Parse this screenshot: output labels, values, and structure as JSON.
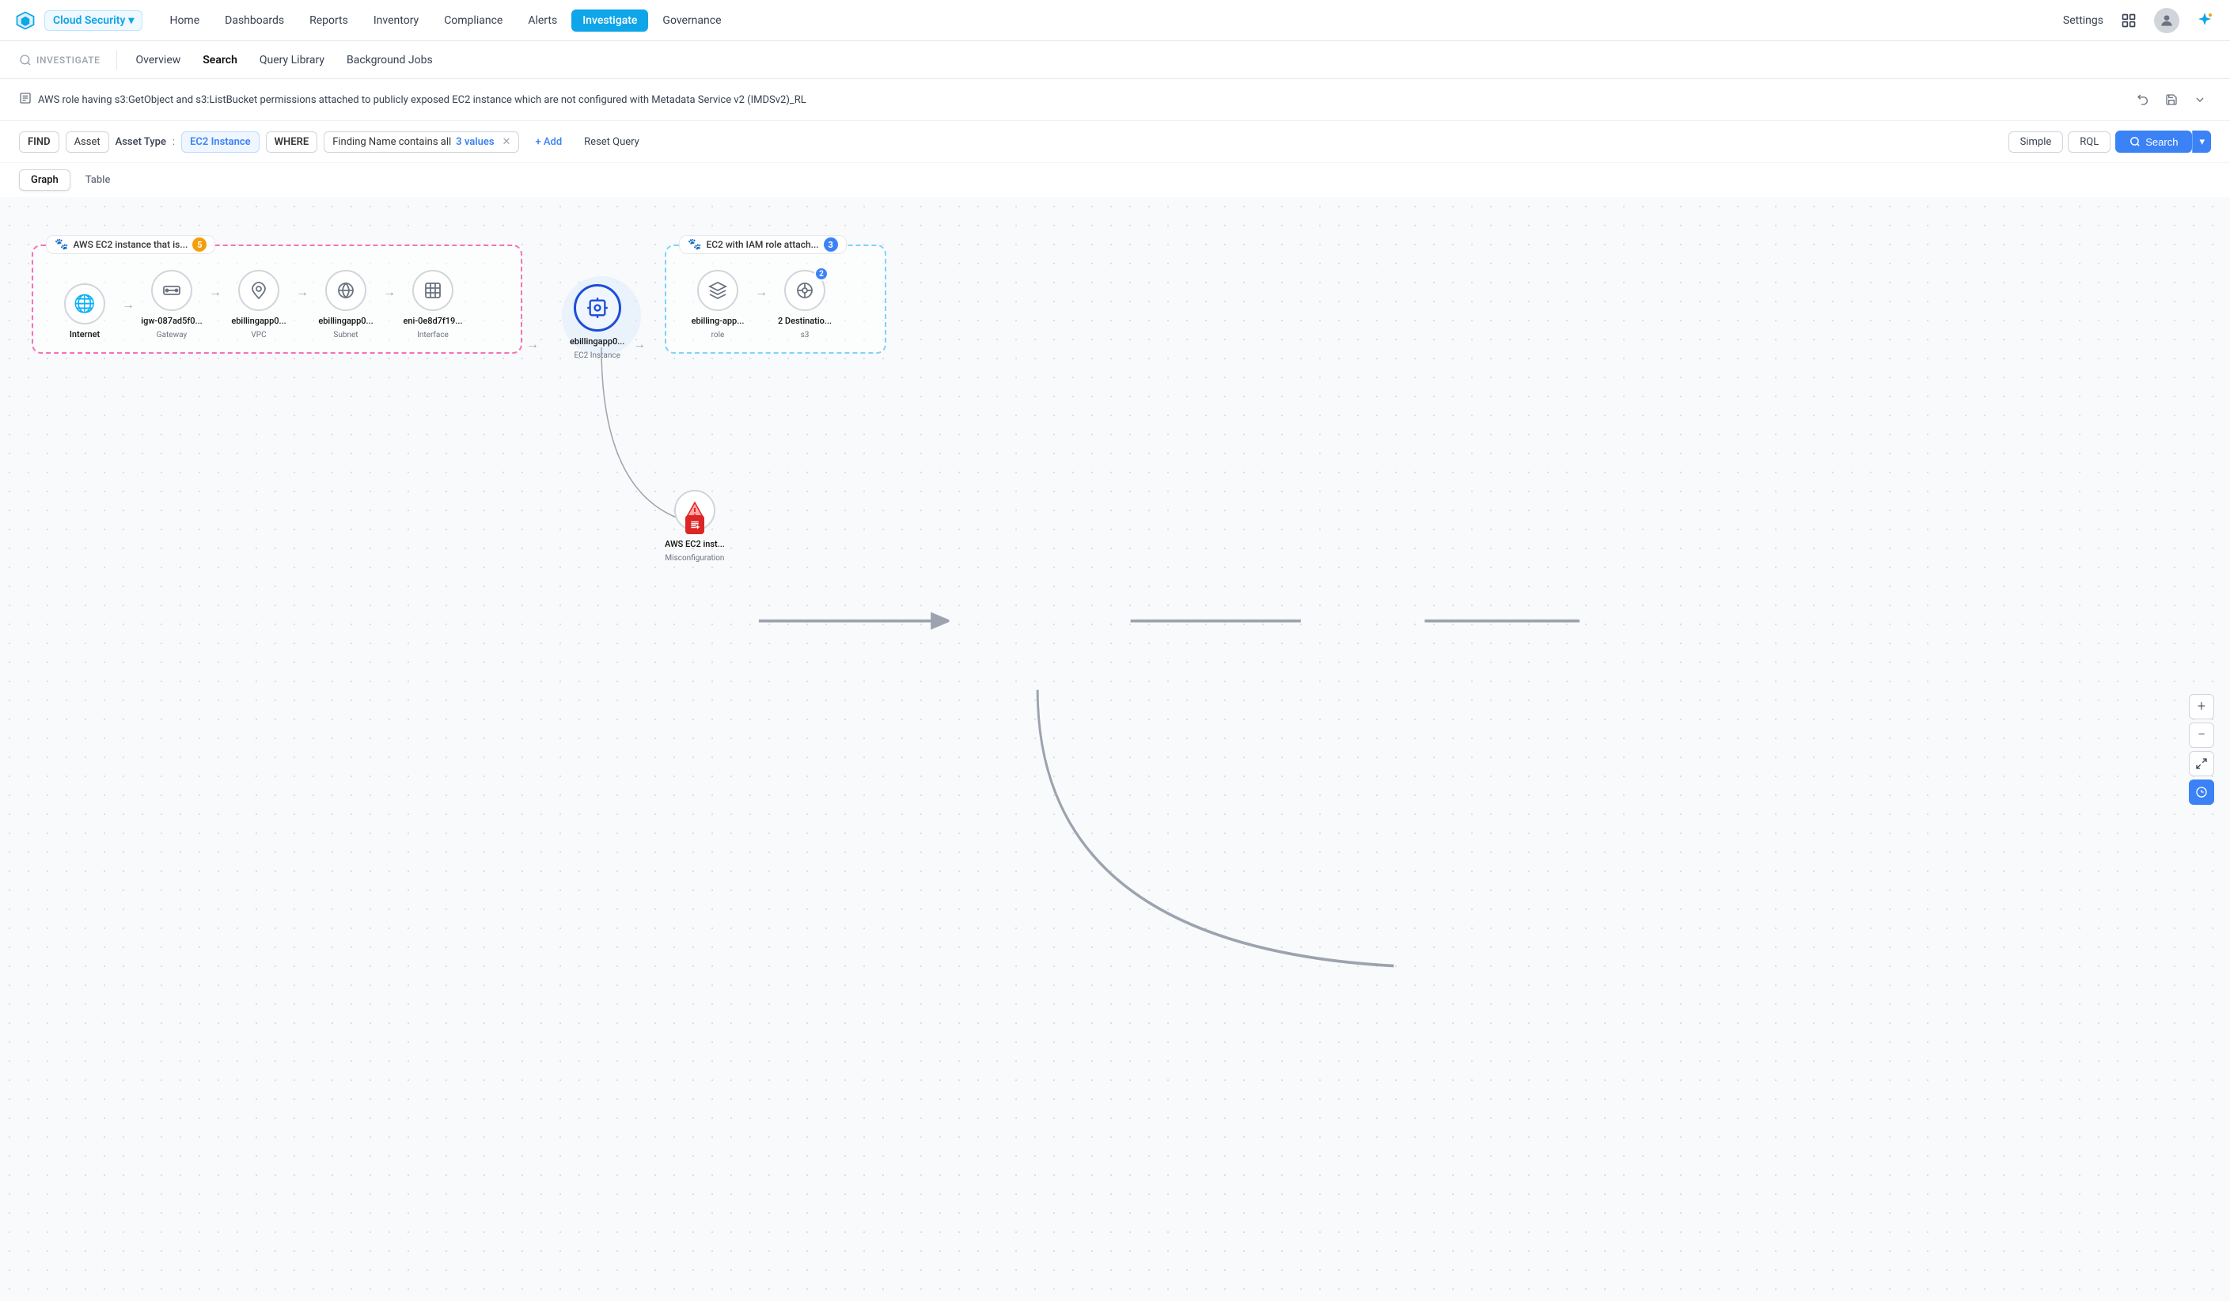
{
  "brand": {
    "name": "Cloud Security",
    "logo_color": "#0ea5e9"
  },
  "top_nav": {
    "items": [
      {
        "label": "Home",
        "active": false
      },
      {
        "label": "Dashboards",
        "active": false
      },
      {
        "label": "Reports",
        "active": false
      },
      {
        "label": "Inventory",
        "active": false
      },
      {
        "label": "Compliance",
        "active": false
      },
      {
        "label": "Alerts",
        "active": false
      },
      {
        "label": "Investigate",
        "active": true
      },
      {
        "label": "Governance",
        "active": false
      }
    ],
    "settings": "Settings"
  },
  "sub_nav": {
    "section": "INVESTIGATE",
    "tabs": [
      {
        "label": "Overview",
        "active": false
      },
      {
        "label": "Search",
        "active": true
      },
      {
        "label": "Query Library",
        "active": false
      },
      {
        "label": "Background Jobs",
        "active": false
      }
    ]
  },
  "query_bar": {
    "text": "AWS role having s3:GetObject and s3:ListBucket permissions attached to publicly exposed EC2 instance which are not configured with Metadata Service v2 (IMDSv2)_RL"
  },
  "filter_bar": {
    "find_label": "FIND",
    "asset_label": "Asset",
    "asset_type_label": "Asset Type",
    "asset_type_colon": ":",
    "asset_type_value": "EC2 Instance",
    "where_label": "WHERE",
    "finding_label": "Finding Name   contains all",
    "finding_values": "3 values",
    "add_label": "+ Add",
    "reset_label": "Reset Query",
    "simple_label": "Simple",
    "rql_label": "RQL",
    "search_label": "Search"
  },
  "view_toggle": {
    "graph_label": "Graph",
    "table_label": "Table"
  },
  "graph": {
    "group1": {
      "label": "AWS EC2 instance that is...",
      "badge": "5"
    },
    "group2": {
      "label": "EC2 with IAM role attach...",
      "badge": "3"
    },
    "nodes": [
      {
        "id": "internet",
        "label": "Internet",
        "sublabel": "",
        "icon": "🌐",
        "type": "normal"
      },
      {
        "id": "gateway",
        "label": "igw-087ad5f0...",
        "sublabel": "Gateway",
        "icon": "⊞",
        "type": "normal"
      },
      {
        "id": "vpc",
        "label": "ebillingapp0...",
        "sublabel": "VPC",
        "icon": "☁",
        "type": "normal"
      },
      {
        "id": "subnet",
        "label": "ebillingapp0...",
        "sublabel": "Subnet",
        "icon": "⎇",
        "type": "normal"
      },
      {
        "id": "interface",
        "label": "eni-0e8d7f19...",
        "sublabel": "Interface",
        "icon": "⊟",
        "type": "normal"
      },
      {
        "id": "ec2main",
        "label": "ebillingapp0...",
        "sublabel": "EC2 Instance",
        "icon": "⚙",
        "type": "ec2-main"
      },
      {
        "id": "role",
        "label": "ebilling-app...",
        "sublabel": "role",
        "icon": "🔐",
        "type": "normal"
      },
      {
        "id": "s3dest",
        "label": "2 Destinatio...",
        "sublabel": "s3",
        "icon": "⊙",
        "type": "normal",
        "badge": "2"
      },
      {
        "id": "misconfig",
        "label": "AWS EC2 inst...",
        "sublabel": "Misconfiguration",
        "icon": "≡",
        "type": "misconfig"
      }
    ],
    "controls": {
      "zoom_in": "+",
      "zoom_out": "−",
      "fit": "⤢",
      "reset": "↺"
    }
  }
}
